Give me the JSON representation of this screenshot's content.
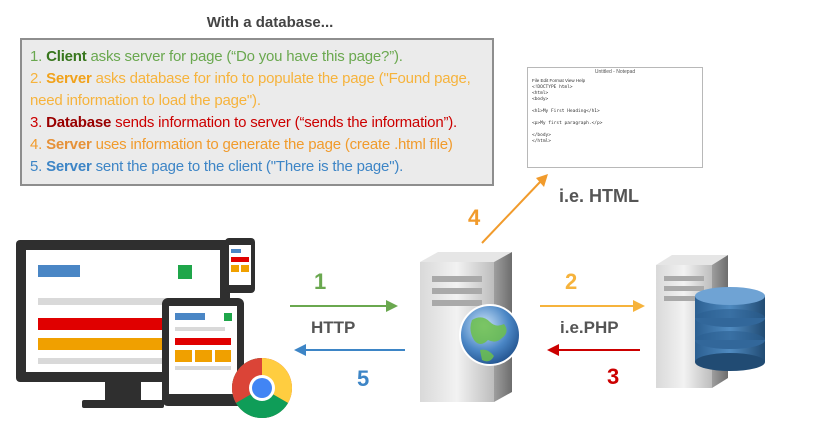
{
  "title": "With a database...",
  "steps": [
    {
      "num": "1.",
      "actor": "Client",
      "text": " asks server for page (“Do you have this page?”).",
      "color": "#6aa84f",
      "actor_color": "#38761d"
    },
    {
      "num": "2.",
      "actor": "Server",
      "text": " asks database for info to populate the page (\"Found page, need information to load the page\").",
      "color": "#f6b33c",
      "actor_color": "#f1a21b"
    },
    {
      "num": "3.",
      "actor": "Database",
      "text": " sends information to server (“sends the information”).",
      "color": "#cc0000",
      "actor_color": "#990000"
    },
    {
      "num": "4.",
      "actor": "Server",
      "text": " uses information to generate the page (create .html file)",
      "color": "#f19b2c",
      "actor_color": "#e69138"
    },
    {
      "num": "5.",
      "actor": "Server",
      "text": " sent the page to the client (\"There is the page\").",
      "color": "#3d85c6",
      "actor_color": "#3d85c6"
    }
  ],
  "arrows": {
    "a1": {
      "num": "1",
      "color": "#6aa84f"
    },
    "a2": {
      "num": "2",
      "color": "#f6b33c"
    },
    "a3": {
      "num": "3",
      "color": "#cc0000"
    },
    "a4": {
      "num": "4",
      "color": "#f19b2c"
    },
    "a5": {
      "num": "5",
      "color": "#3d85c6"
    }
  },
  "labels": {
    "http": "HTTP",
    "php": "i.e.PHP",
    "html": "i.e. HTML"
  },
  "notepad": {
    "title": "Untitled - Notepad",
    "menu": "File  Edit  Format  View  Help",
    "lines": "<!DOCTYPE html>\n<html>\n<body>\n\n<h1>My First Heading</h1>\n\n<p>My first paragraph.</p>\n\n</body>\n</html>"
  }
}
